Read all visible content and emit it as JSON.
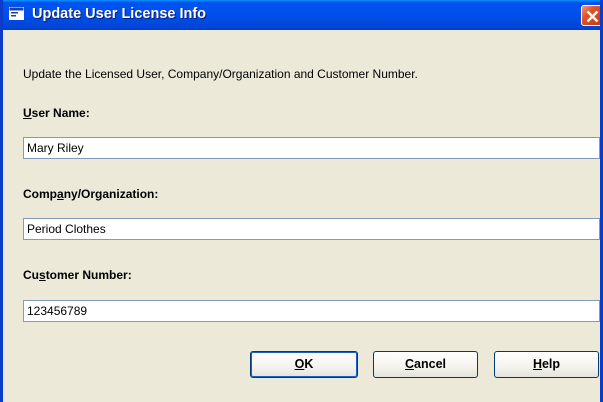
{
  "window": {
    "title": "Update User License Info",
    "close_icon": "close-icon",
    "app_icon": "dialog-icon"
  },
  "instruction": "Update the Licensed User, Company/Organization and Customer Number.",
  "fields": {
    "user_name": {
      "label_pre": "",
      "label_u": "U",
      "label_post": "ser Name:",
      "value": "Mary Riley"
    },
    "company": {
      "label_pre": "Comp",
      "label_u": "a",
      "label_post": "ny/Organization:",
      "value": "Period Clothes"
    },
    "customer_number": {
      "label_pre": "Cu",
      "label_u": "s",
      "label_post": "tomer Number:",
      "value": "123456789"
    }
  },
  "buttons": {
    "ok": {
      "pre": "",
      "u": "O",
      "post": "K"
    },
    "cancel": {
      "pre": "",
      "u": "C",
      "post": "ancel"
    },
    "help": {
      "pre": "",
      "u": "H",
      "post": "elp"
    }
  },
  "colors": {
    "titlebar": "#0053ee",
    "dialog_bg": "#ece9d8",
    "close_button": "#e0532a",
    "textbox_border": "#7f9db9",
    "button_border": "#003c74"
  }
}
